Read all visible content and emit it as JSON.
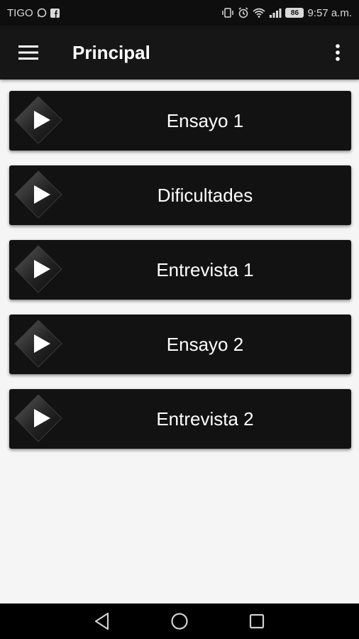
{
  "status_bar": {
    "carrier": "TIGO",
    "battery": "86",
    "time": "9:57 a.m."
  },
  "app_bar": {
    "title": "Principal"
  },
  "items": [
    {
      "label": "Ensayo 1"
    },
    {
      "label": "Dificultades"
    },
    {
      "label": "Entrevista 1"
    },
    {
      "label": "Ensayo 2"
    },
    {
      "label": "Entrevista 2"
    }
  ],
  "icons": {
    "menu": "hamburger-menu-icon",
    "overflow": "more-vert-icon",
    "play": "play-icon",
    "back": "back-triangle-icon",
    "home": "home-circle-icon",
    "recents": "recents-square-icon"
  },
  "colors": {
    "app_bar": "#161616",
    "card": "#121212",
    "background": "#f5f5f5"
  }
}
